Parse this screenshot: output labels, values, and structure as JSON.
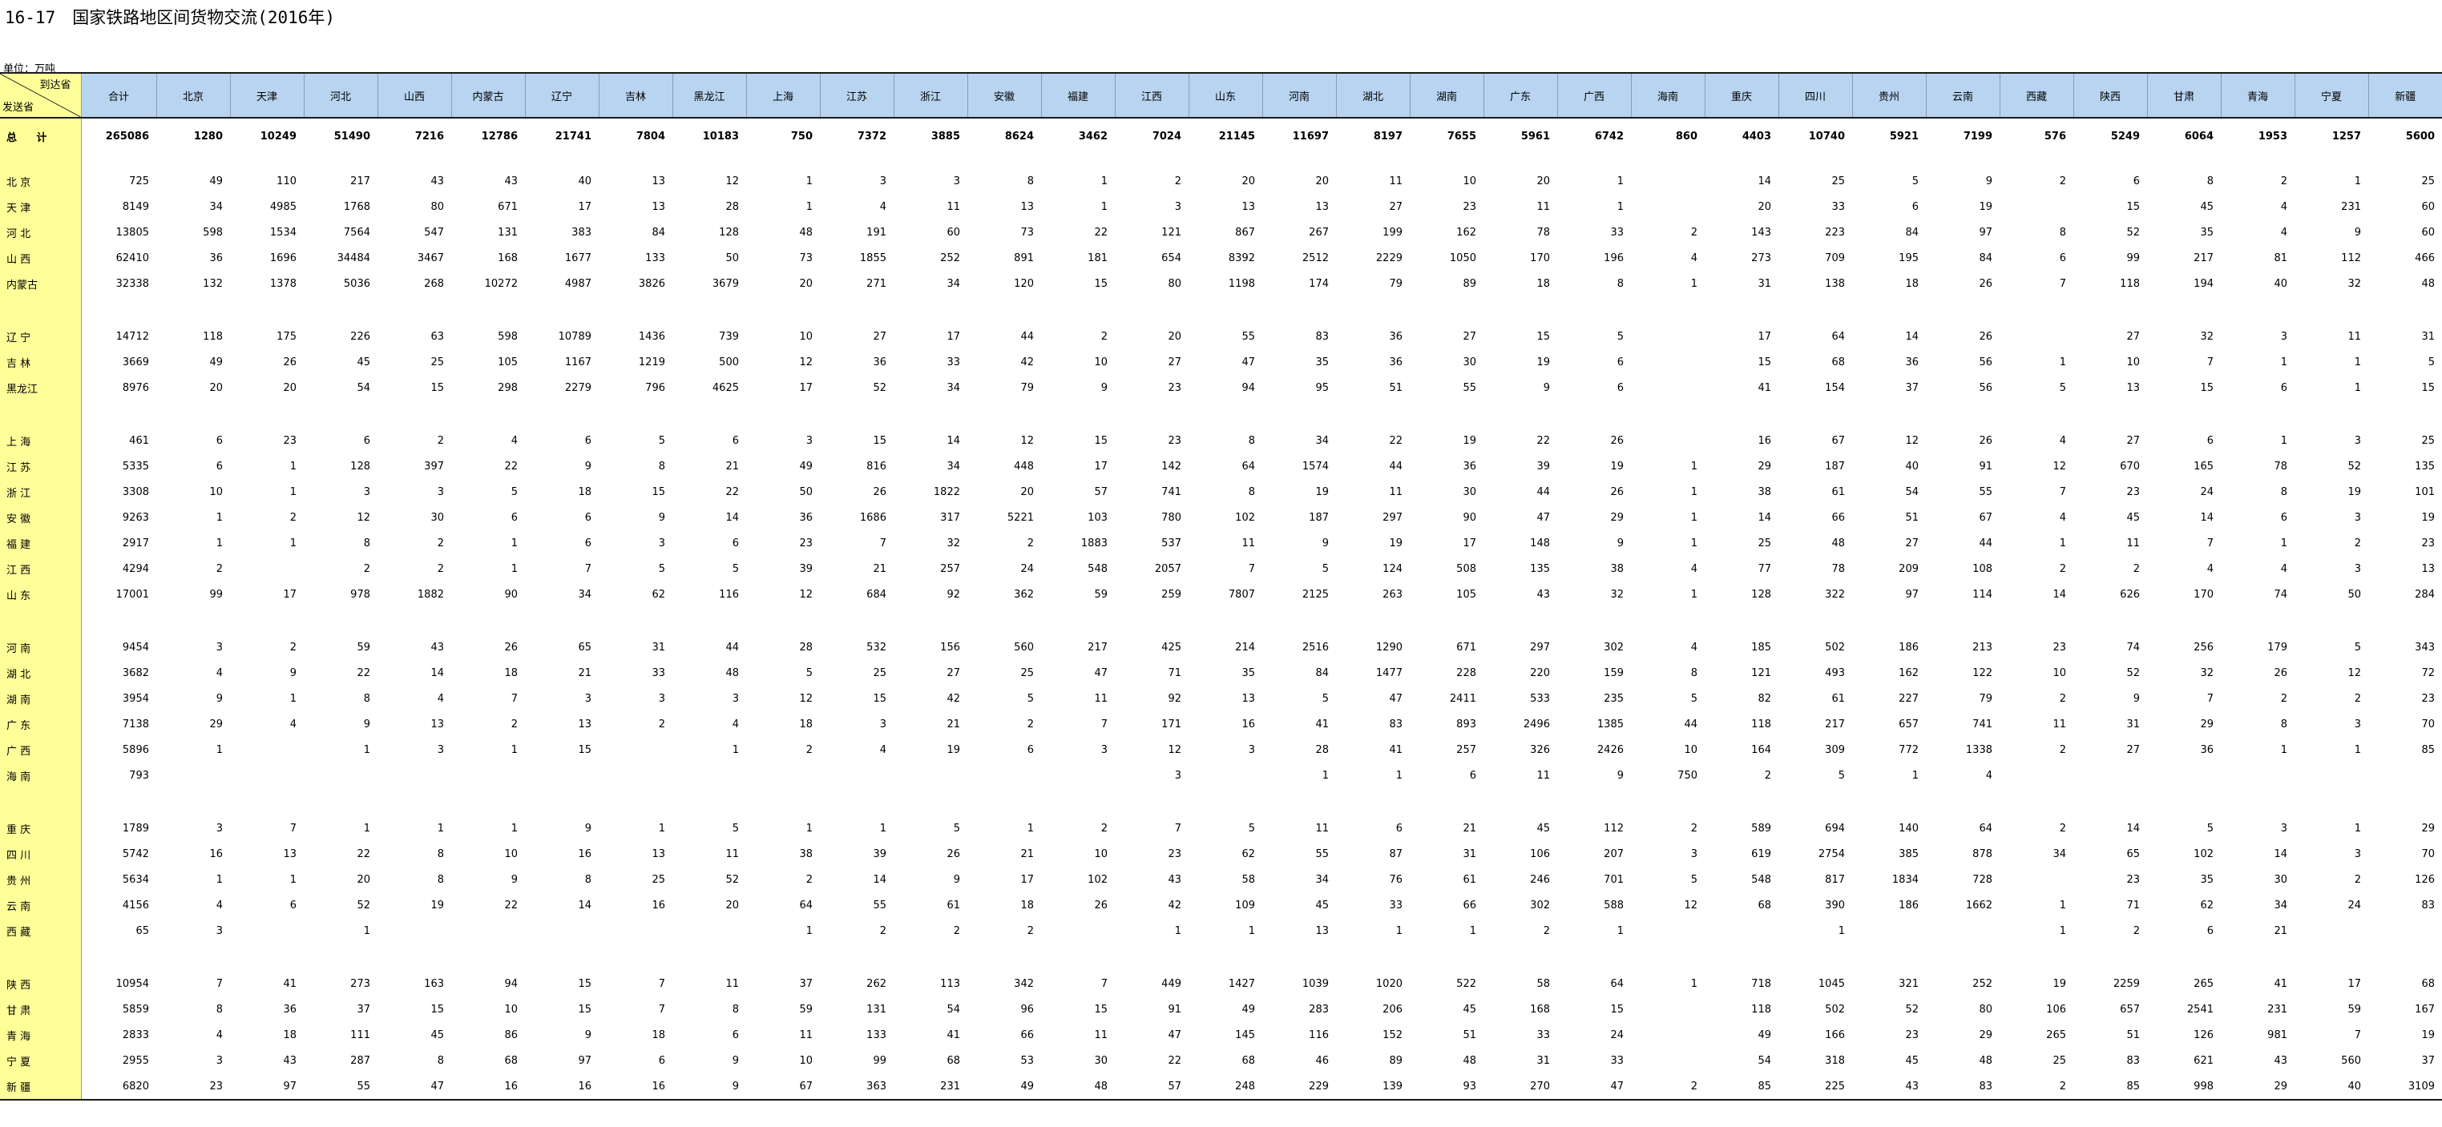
{
  "title": "16-17　国家铁路地区间货物交流(2016年)",
  "unit": "单位：万吨",
  "corner": {
    "to": "到达省",
    "from": "发送省"
  },
  "columns": [
    "合计",
    "北京",
    "天津",
    "河北",
    "山西",
    "内蒙古",
    "辽宁",
    "吉林",
    "黑龙江",
    "上海",
    "江苏",
    "浙江",
    "安徽",
    "福建",
    "江西",
    "山东",
    "河南",
    "湖北",
    "湖南",
    "广东",
    "广西",
    "海南",
    "重庆",
    "四川",
    "贵州",
    "云南",
    "西藏",
    "陕西",
    "甘肃",
    "青海",
    "宁夏",
    "新疆"
  ],
  "total": {
    "label": "总 计",
    "values": [
      "265086",
      "1280",
      "10249",
      "51490",
      "7216",
      "12786",
      "21741",
      "7804",
      "10183",
      "750",
      "7372",
      "3885",
      "8624",
      "3462",
      "7024",
      "21145",
      "11697",
      "8197",
      "7655",
      "5961",
      "6742",
      "860",
      "4403",
      "10740",
      "5921",
      "7199",
      "576",
      "5249",
      "6064",
      "1953",
      "1257",
      "5600"
    ]
  },
  "groups": [
    [
      {
        "label": "北 京",
        "values": [
          "725",
          "49",
          "110",
          "217",
          "43",
          "43",
          "40",
          "13",
          "12",
          "1",
          "3",
          "3",
          "8",
          "1",
          "2",
          "20",
          "20",
          "11",
          "10",
          "20",
          "1",
          "",
          "14",
          "25",
          "5",
          "9",
          "2",
          "6",
          "8",
          "2",
          "1",
          "25"
        ]
      },
      {
        "label": "天 津",
        "values": [
          "8149",
          "34",
          "4985",
          "1768",
          "80",
          "671",
          "17",
          "13",
          "28",
          "1",
          "4",
          "11",
          "13",
          "1",
          "3",
          "13",
          "13",
          "27",
          "23",
          "11",
          "1",
          "",
          "20",
          "33",
          "6",
          "19",
          "",
          "15",
          "45",
          "4",
          "231",
          "60"
        ]
      },
      {
        "label": "河 北",
        "values": [
          "13805",
          "598",
          "1534",
          "7564",
          "547",
          "131",
          "383",
          "84",
          "128",
          "48",
          "191",
          "60",
          "73",
          "22",
          "121",
          "867",
          "267",
          "199",
          "162",
          "78",
          "33",
          "2",
          "143",
          "223",
          "84",
          "97",
          "8",
          "52",
          "35",
          "4",
          "9",
          "60"
        ]
      },
      {
        "label": "山 西",
        "values": [
          "62410",
          "36",
          "1696",
          "34484",
          "3467",
          "168",
          "1677",
          "133",
          "50",
          "73",
          "1855",
          "252",
          "891",
          "181",
          "654",
          "8392",
          "2512",
          "2229",
          "1050",
          "170",
          "196",
          "4",
          "273",
          "709",
          "195",
          "84",
          "6",
          "99",
          "217",
          "81",
          "112",
          "466"
        ]
      },
      {
        "label": "内蒙古",
        "values": [
          "32338",
          "132",
          "1378",
          "5036",
          "268",
          "10272",
          "4987",
          "3826",
          "3679",
          "20",
          "271",
          "34",
          "120",
          "15",
          "80",
          "1198",
          "174",
          "79",
          "89",
          "18",
          "8",
          "1",
          "31",
          "138",
          "18",
          "26",
          "7",
          "118",
          "194",
          "40",
          "32",
          "48"
        ]
      }
    ],
    [
      {
        "label": "辽 宁",
        "values": [
          "14712",
          "118",
          "175",
          "226",
          "63",
          "598",
          "10789",
          "1436",
          "739",
          "10",
          "27",
          "17",
          "44",
          "2",
          "20",
          "55",
          "83",
          "36",
          "27",
          "15",
          "5",
          "",
          "17",
          "64",
          "14",
          "26",
          "",
          "27",
          "32",
          "3",
          "11",
          "31"
        ]
      },
      {
        "label": "吉 林",
        "values": [
          "3669",
          "49",
          "26",
          "45",
          "25",
          "105",
          "1167",
          "1219",
          "500",
          "12",
          "36",
          "33",
          "42",
          "10",
          "27",
          "47",
          "35",
          "36",
          "30",
          "19",
          "6",
          "",
          "15",
          "68",
          "36",
          "56",
          "1",
          "10",
          "7",
          "1",
          "1",
          "5"
        ]
      },
      {
        "label": "黑龙江",
        "values": [
          "8976",
          "20",
          "20",
          "54",
          "15",
          "298",
          "2279",
          "796",
          "4625",
          "17",
          "52",
          "34",
          "79",
          "9",
          "23",
          "94",
          "95",
          "51",
          "55",
          "9",
          "6",
          "",
          "41",
          "154",
          "37",
          "56",
          "5",
          "13",
          "15",
          "6",
          "1",
          "15"
        ]
      }
    ],
    [
      {
        "label": "上 海",
        "values": [
          "461",
          "6",
          "23",
          "6",
          "2",
          "4",
          "6",
          "5",
          "6",
          "3",
          "15",
          "14",
          "12",
          "15",
          "23",
          "8",
          "34",
          "22",
          "19",
          "22",
          "26",
          "",
          "16",
          "67",
          "12",
          "26",
          "4",
          "27",
          "6",
          "1",
          "3",
          "25"
        ]
      },
      {
        "label": "江 苏",
        "values": [
          "5335",
          "6",
          "1",
          "128",
          "397",
          "22",
          "9",
          "8",
          "21",
          "49",
          "816",
          "34",
          "448",
          "17",
          "142",
          "64",
          "1574",
          "44",
          "36",
          "39",
          "19",
          "1",
          "29",
          "187",
          "40",
          "91",
          "12",
          "670",
          "165",
          "78",
          "52",
          "135"
        ]
      },
      {
        "label": "浙 江",
        "values": [
          "3308",
          "10",
          "1",
          "3",
          "3",
          "5",
          "18",
          "15",
          "22",
          "50",
          "26",
          "1822",
          "20",
          "57",
          "741",
          "8",
          "19",
          "11",
          "30",
          "44",
          "26",
          "1",
          "38",
          "61",
          "54",
          "55",
          "7",
          "23",
          "24",
          "8",
          "19",
          "101"
        ]
      },
      {
        "label": "安 徽",
        "values": [
          "9263",
          "1",
          "2",
          "12",
          "30",
          "6",
          "6",
          "9",
          "14",
          "36",
          "1686",
          "317",
          "5221",
          "103",
          "780",
          "102",
          "187",
          "297",
          "90",
          "47",
          "29",
          "1",
          "14",
          "66",
          "51",
          "67",
          "4",
          "45",
          "14",
          "6",
          "3",
          "19"
        ]
      },
      {
        "label": "福 建",
        "values": [
          "2917",
          "1",
          "1",
          "8",
          "2",
          "1",
          "6",
          "3",
          "6",
          "23",
          "7",
          "32",
          "2",
          "1883",
          "537",
          "11",
          "9",
          "19",
          "17",
          "148",
          "9",
          "1",
          "25",
          "48",
          "27",
          "44",
          "1",
          "11",
          "7",
          "1",
          "2",
          "23"
        ]
      },
      {
        "label": "江 西",
        "values": [
          "4294",
          "2",
          "",
          "2",
          "2",
          "1",
          "7",
          "5",
          "5",
          "39",
          "21",
          "257",
          "24",
          "548",
          "2057",
          "7",
          "5",
          "124",
          "508",
          "135",
          "38",
          "4",
          "77",
          "78",
          "209",
          "108",
          "2",
          "2",
          "4",
          "4",
          "3",
          "13"
        ]
      },
      {
        "label": "山 东",
        "values": [
          "17001",
          "99",
          "17",
          "978",
          "1882",
          "90",
          "34",
          "62",
          "116",
          "12",
          "684",
          "92",
          "362",
          "59",
          "259",
          "7807",
          "2125",
          "263",
          "105",
          "43",
          "32",
          "1",
          "128",
          "322",
          "97",
          "114",
          "14",
          "626",
          "170",
          "74",
          "50",
          "284"
        ]
      }
    ],
    [
      {
        "label": "河 南",
        "values": [
          "9454",
          "3",
          "2",
          "59",
          "43",
          "26",
          "65",
          "31",
          "44",
          "28",
          "532",
          "156",
          "560",
          "217",
          "425",
          "214",
          "2516",
          "1290",
          "671",
          "297",
          "302",
          "4",
          "185",
          "502",
          "186",
          "213",
          "23",
          "74",
          "256",
          "179",
          "5",
          "343"
        ]
      },
      {
        "label": "湖 北",
        "values": [
          "3682",
          "4",
          "9",
          "22",
          "14",
          "18",
          "21",
          "33",
          "48",
          "5",
          "25",
          "27",
          "25",
          "47",
          "71",
          "35",
          "84",
          "1477",
          "228",
          "220",
          "159",
          "8",
          "121",
          "493",
          "162",
          "122",
          "10",
          "52",
          "32",
          "26",
          "12",
          "72"
        ]
      },
      {
        "label": "湖 南",
        "values": [
          "3954",
          "9",
          "1",
          "8",
          "4",
          "7",
          "3",
          "3",
          "3",
          "12",
          "15",
          "42",
          "5",
          "11",
          "92",
          "13",
          "5",
          "47",
          "2411",
          "533",
          "235",
          "5",
          "82",
          "61",
          "227",
          "79",
          "2",
          "9",
          "7",
          "2",
          "2",
          "23"
        ]
      },
      {
        "label": "广 东",
        "values": [
          "7138",
          "29",
          "4",
          "9",
          "13",
          "2",
          "13",
          "2",
          "4",
          "18",
          "3",
          "21",
          "2",
          "7",
          "171",
          "16",
          "41",
          "83",
          "893",
          "2496",
          "1385",
          "44",
          "118",
          "217",
          "657",
          "741",
          "11",
          "31",
          "29",
          "8",
          "3",
          "70"
        ]
      },
      {
        "label": "广 西",
        "values": [
          "5896",
          "1",
          "",
          "1",
          "3",
          "1",
          "15",
          "",
          "1",
          "2",
          "4",
          "19",
          "6",
          "3",
          "12",
          "3",
          "28",
          "41",
          "257",
          "326",
          "2426",
          "10",
          "164",
          "309",
          "772",
          "1338",
          "2",
          "27",
          "36",
          "1",
          "1",
          "85"
        ]
      },
      {
        "label": "海 南",
        "values": [
          "793",
          "",
          "",
          "",
          "",
          "",
          "",
          "",
          "",
          "",
          "",
          "",
          "",
          "",
          "3",
          "",
          "1",
          "1",
          "6",
          "11",
          "9",
          "750",
          "2",
          "5",
          "1",
          "4",
          "",
          "",
          "",
          "",
          "",
          ""
        ]
      }
    ],
    [
      {
        "label": "重 庆",
        "values": [
          "1789",
          "3",
          "7",
          "1",
          "1",
          "1",
          "9",
          "1",
          "5",
          "1",
          "1",
          "5",
          "1",
          "2",
          "7",
          "5",
          "11",
          "6",
          "21",
          "45",
          "112",
          "2",
          "589",
          "694",
          "140",
          "64",
          "2",
          "14",
          "5",
          "3",
          "1",
          "29"
        ]
      },
      {
        "label": "四 川",
        "values": [
          "5742",
          "16",
          "13",
          "22",
          "8",
          "10",
          "16",
          "13",
          "11",
          "38",
          "39",
          "26",
          "21",
          "10",
          "23",
          "62",
          "55",
          "87",
          "31",
          "106",
          "207",
          "3",
          "619",
          "2754",
          "385",
          "878",
          "34",
          "65",
          "102",
          "14",
          "3",
          "70"
        ]
      },
      {
        "label": "贵 州",
        "values": [
          "5634",
          "1",
          "1",
          "20",
          "8",
          "9",
          "8",
          "25",
          "52",
          "2",
          "14",
          "9",
          "17",
          "102",
          "43",
          "58",
          "34",
          "76",
          "61",
          "246",
          "701",
          "5",
          "548",
          "817",
          "1834",
          "728",
          "",
          "23",
          "35",
          "30",
          "2",
          "126"
        ]
      },
      {
        "label": "云 南",
        "values": [
          "4156",
          "4",
          "6",
          "52",
          "19",
          "22",
          "14",
          "16",
          "20",
          "64",
          "55",
          "61",
          "18",
          "26",
          "42",
          "109",
          "45",
          "33",
          "66",
          "302",
          "588",
          "12",
          "68",
          "390",
          "186",
          "1662",
          "1",
          "71",
          "62",
          "34",
          "24",
          "83"
        ]
      },
      {
        "label": "西 藏",
        "values": [
          "65",
          "3",
          "",
          "1",
          "",
          "",
          "",
          "",
          "",
          "1",
          "2",
          "2",
          "2",
          "",
          "1",
          "1",
          "13",
          "1",
          "1",
          "2",
          "1",
          "",
          "",
          "1",
          "",
          "",
          "1",
          "2",
          "6",
          "21",
          "",
          ""
        ]
      }
    ],
    [
      {
        "label": "陕 西",
        "values": [
          "10954",
          "7",
          "41",
          "273",
          "163",
          "94",
          "15",
          "7",
          "11",
          "37",
          "262",
          "113",
          "342",
          "7",
          "449",
          "1427",
          "1039",
          "1020",
          "522",
          "58",
          "64",
          "1",
          "718",
          "1045",
          "321",
          "252",
          "19",
          "2259",
          "265",
          "41",
          "17",
          "68"
        ]
      },
      {
        "label": "甘 肃",
        "values": [
          "5859",
          "8",
          "36",
          "37",
          "15",
          "10",
          "15",
          "7",
          "8",
          "59",
          "131",
          "54",
          "96",
          "15",
          "91",
          "49",
          "283",
          "206",
          "45",
          "168",
          "15",
          "",
          "118",
          "502",
          "52",
          "80",
          "106",
          "657",
          "2541",
          "231",
          "59",
          "167"
        ]
      },
      {
        "label": "青 海",
        "values": [
          "2833",
          "4",
          "18",
          "111",
          "45",
          "86",
          "9",
          "18",
          "6",
          "11",
          "133",
          "41",
          "66",
          "11",
          "47",
          "145",
          "116",
          "152",
          "51",
          "33",
          "24",
          "",
          "49",
          "166",
          "23",
          "29",
          "265",
          "51",
          "126",
          "981",
          "7",
          "19"
        ]
      },
      {
        "label": "宁 夏",
        "values": [
          "2955",
          "3",
          "43",
          "287",
          "8",
          "68",
          "97",
          "6",
          "9",
          "10",
          "99",
          "68",
          "53",
          "30",
          "22",
          "68",
          "46",
          "89",
          "48",
          "31",
          "33",
          "",
          "54",
          "318",
          "45",
          "48",
          "25",
          "83",
          "621",
          "43",
          "560",
          "37"
        ]
      },
      {
        "label": "新 疆",
        "values": [
          "6820",
          "23",
          "97",
          "55",
          "47",
          "16",
          "16",
          "16",
          "9",
          "67",
          "363",
          "231",
          "49",
          "48",
          "57",
          "248",
          "229",
          "139",
          "93",
          "270",
          "47",
          "2",
          "85",
          "225",
          "43",
          "83",
          "2",
          "85",
          "998",
          "29",
          "40",
          "3109"
        ]
      }
    ]
  ]
}
